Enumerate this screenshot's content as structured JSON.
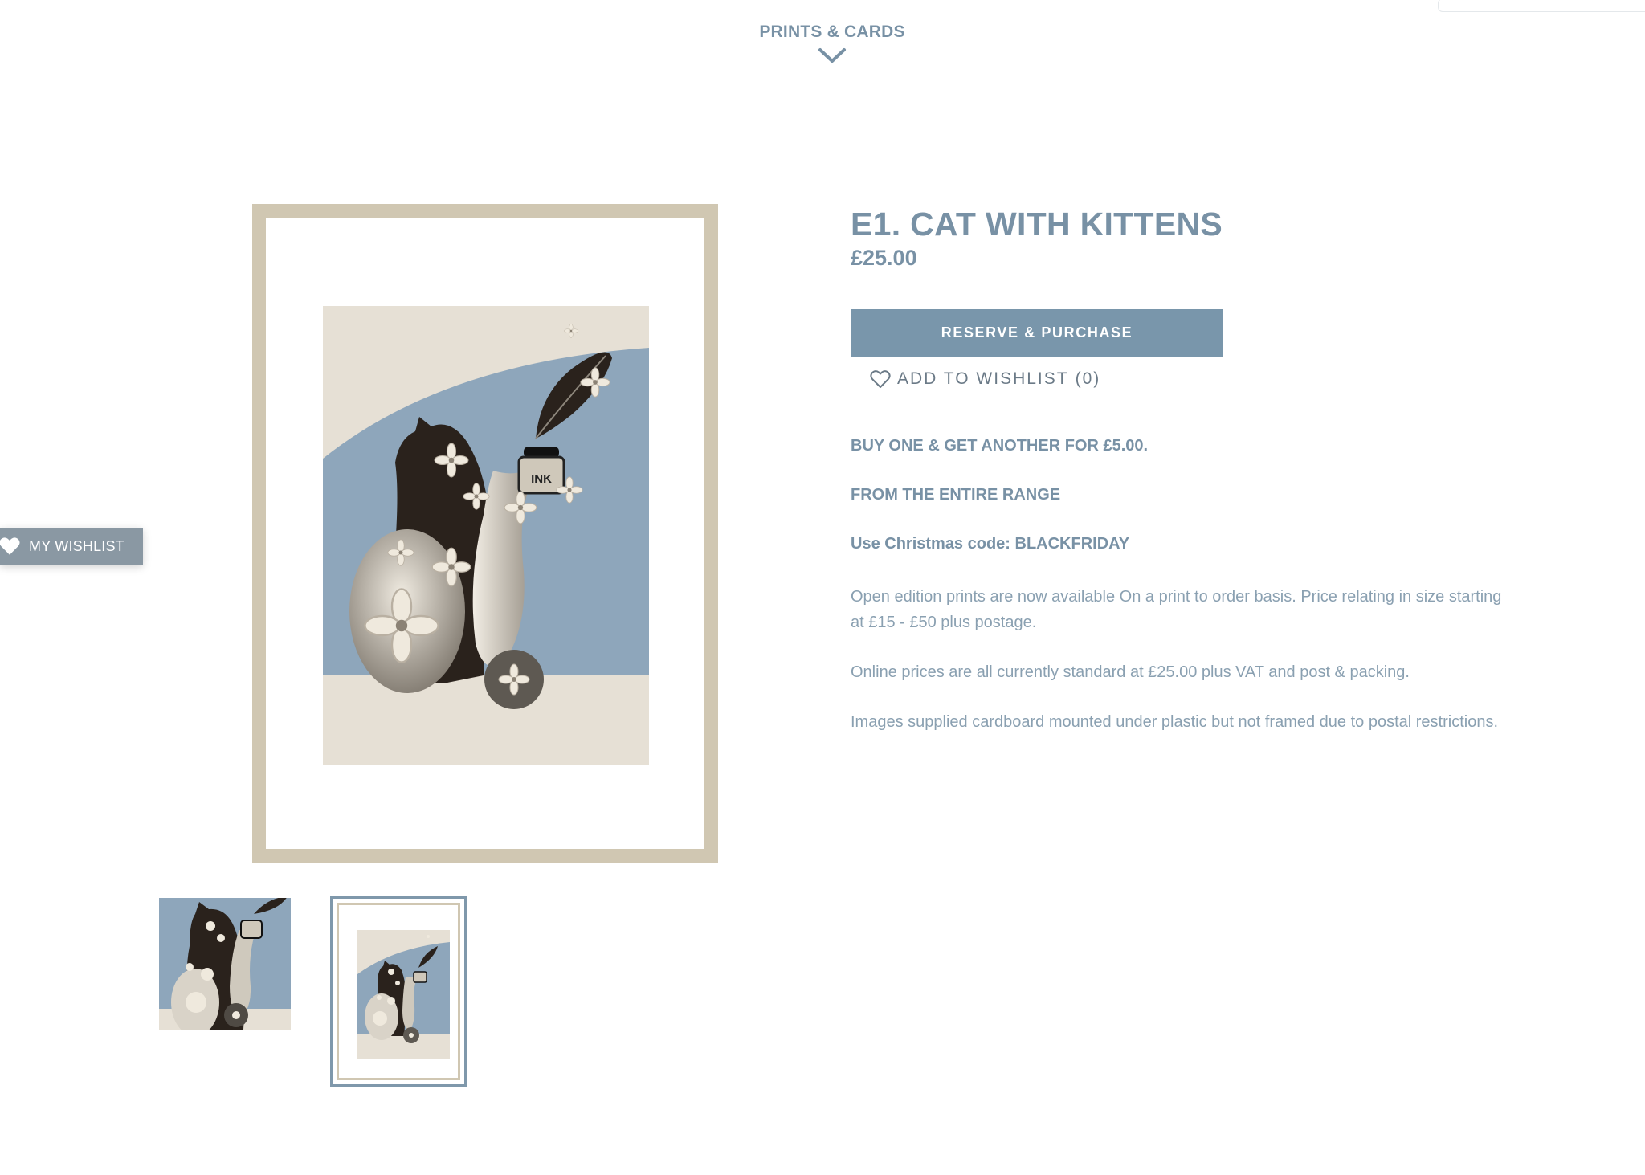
{
  "nav": {
    "category_label": "PRINTS & CARDS"
  },
  "product": {
    "title": "E1. CAT WITH KITTENS",
    "price": "£25.00",
    "purchase_label": "RESERVE & PURCHASE",
    "wishlist_label": "ADD TO WISHLIST",
    "wishlist_count": "(0)",
    "promo": [
      "BUY ONE & GET ANOTHER FOR £5.00.",
      "FROM THE ENTIRE RANGE",
      "Use Christmas code:  BLACKFRIDAY"
    ],
    "description": [
      "Open edition prints are now available On a print to order basis.  Price relating in size starting at £15 - £50 plus postage.",
      "Online prices are all currently standard at £25.00 plus VAT and post & packing.",
      "Images supplied cardboard mounted under plastic but not framed due to postal restrictions."
    ]
  },
  "artwork": {
    "ink_label": "INK"
  },
  "floating_wishlist": {
    "label": "MY WISHLIST"
  },
  "colors": {
    "accent": "#7996ab",
    "frame": "#d0c7b2",
    "print_bg": "#e6e0d5",
    "print_blue": "#8ea6bb",
    "cat_dark": "#2a221c"
  },
  "icons": [
    "chevron-down-icon",
    "heart-outline-icon",
    "heart-filled-icon"
  ]
}
